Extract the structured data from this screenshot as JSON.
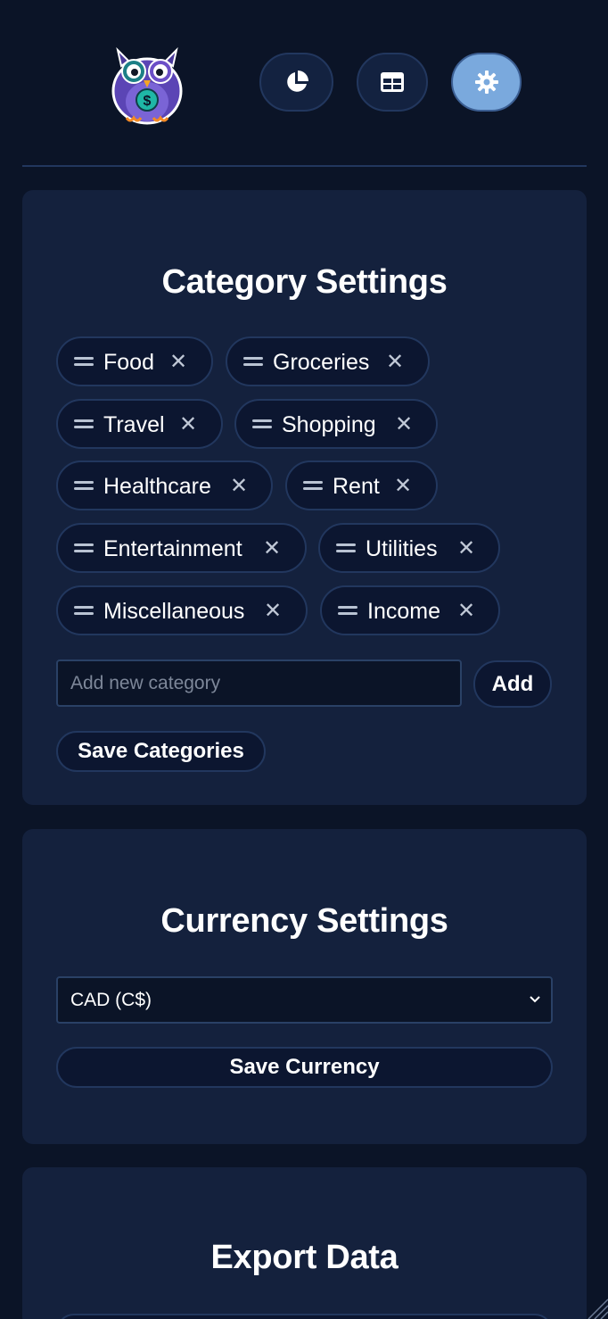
{
  "header": {
    "nav": [
      {
        "icon": "pie-chart-icon",
        "active": false
      },
      {
        "icon": "table-icon",
        "active": false
      },
      {
        "icon": "gear-icon",
        "active": true
      }
    ]
  },
  "category_settings": {
    "title": "Category Settings",
    "categories": [
      "Food",
      "Groceries",
      "Travel",
      "Shopping",
      "Healthcare",
      "Rent",
      "Entertainment",
      "Utilities",
      "Miscellaneous",
      "Income"
    ],
    "remove_glyph": "✕",
    "new_category_placeholder": "Add new category",
    "add_label": "Add",
    "save_label": "Save Categories"
  },
  "currency_settings": {
    "title": "Currency Settings",
    "selected": "CAD (C$)",
    "save_label": "Save Currency"
  },
  "export_data": {
    "title": "Export Data"
  },
  "colors": {
    "background": "#0b1427",
    "panel": "#14213d",
    "accent_active": "#7aa9dd",
    "border": "#22375e"
  }
}
